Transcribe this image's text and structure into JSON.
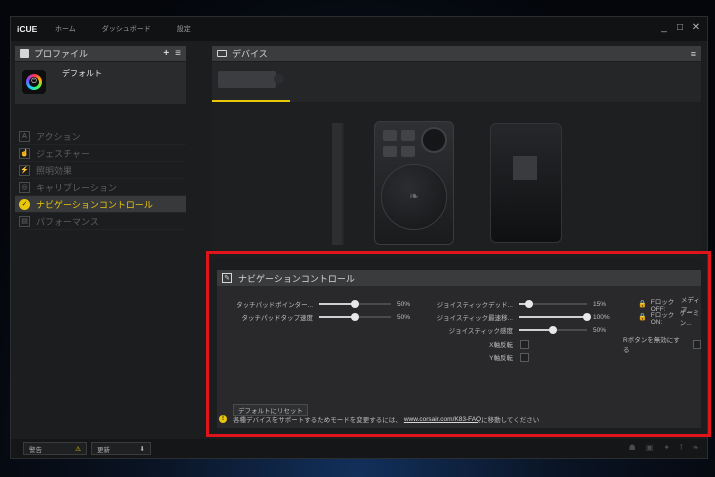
{
  "app": {
    "brand": "iCUE",
    "nav": [
      "ホーム",
      "ダッシュボード",
      "設定"
    ],
    "window_controls": [
      "_",
      "□",
      "✕"
    ]
  },
  "profiles": {
    "title": "プロファイル",
    "add": "+",
    "menu": "≡",
    "active_profile": "デフォルト"
  },
  "menu": {
    "items": [
      {
        "label": "アクション",
        "icon": "A"
      },
      {
        "label": "ジェスチャー",
        "icon": "☝"
      },
      {
        "label": "照明効果",
        "icon": "⚡"
      },
      {
        "label": "キャリブレーション",
        "icon": "◎"
      },
      {
        "label": "ナビゲーションコントロール",
        "icon": "✓"
      },
      {
        "label": "パフォーマンス",
        "icon": "▤"
      }
    ]
  },
  "devices": {
    "title": "デバイス",
    "menu": "≡"
  },
  "nav_control": {
    "title": "ナビゲーションコントロール",
    "touchpad_pointer": {
      "label": "タッチパッドポインター...",
      "value": "50%",
      "level": 0.5
    },
    "touchpad_tap": {
      "label": "タッチパッドタップ速度",
      "value": "50%",
      "level": 0.5
    },
    "joystick_dead": {
      "label": "ジョイスティックデッド...",
      "value": "15%",
      "level": 0.15
    },
    "joystick_max": {
      "label": "ジョイスティック最速移...",
      "value": "100%",
      "level": 1.0
    },
    "joystick_sens": {
      "label": "ジョイスティック感度",
      "value": "50%",
      "level": 0.5
    },
    "x_invert": "X軸反転",
    "y_invert": "Y軸反転",
    "flock_off": "Fロック OFF:",
    "flock_off_val": "メディア...",
    "flock_on": "Fロック ON:",
    "flock_on_val": "ゲーミン...",
    "r_button": "Rボタンを無効にする",
    "reset": "デフォルトにリセット",
    "info_text": "各種デバイスをサポートするためモードを変更するには、",
    "info_link": "www.corsair.com/K83-FAQ",
    "info_suffix": "に移動してください"
  },
  "bottom": {
    "warning": "警告",
    "warning_icon": "⚠",
    "update": "更新",
    "update_icon": "⬇"
  },
  "colors": {
    "accent": "#e9c70b",
    "highlight_box": "#e1141c"
  }
}
